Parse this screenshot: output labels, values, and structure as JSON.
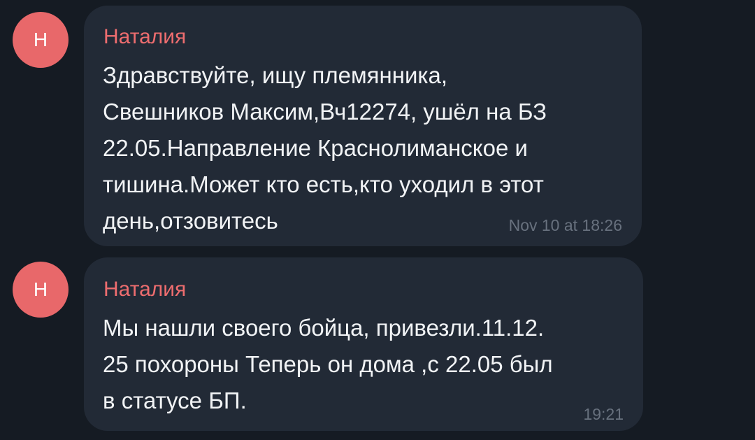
{
  "colors": {
    "background": "#151b23",
    "bubble": "#222a36",
    "avatar": "#e8686a",
    "sender_name": "#ee6d6f",
    "message_text": "#f1f3f5",
    "timestamp": "#68717e"
  },
  "messages": [
    {
      "avatar_initial": "Н",
      "sender": "Наталия",
      "text": "Здравствуйте, ищу племянника,\nСвешников Максим,Вч12274, ушёл на БЗ\n22.05.Направление Краснолиманское и\nтишина.Может кто есть,кто уходил в этот\nдень,отзовитесь",
      "time": "Nov 10 at 18:26"
    },
    {
      "avatar_initial": "Н",
      "sender": "Наталия",
      "text": "Мы нашли своего бойца, привезли.11.12.\n25 похороны Теперь он дома ,с 22.05 был\nв статусе БП.",
      "time": "19:21"
    }
  ]
}
